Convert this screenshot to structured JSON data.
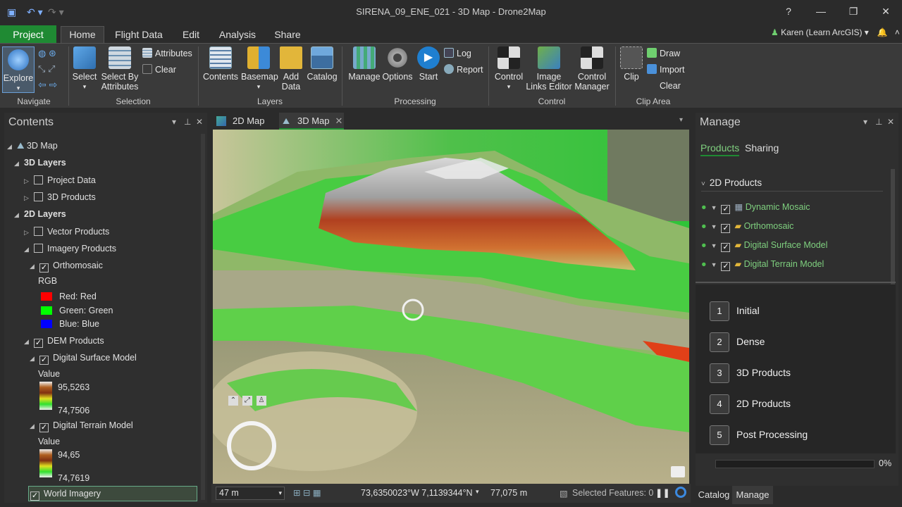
{
  "window": {
    "title": "SIRENA_09_ENE_021 - 3D Map - Drone2Map",
    "controls": [
      "?",
      "—",
      "❐",
      "✕"
    ]
  },
  "ribbon_tabs": [
    "Project",
    "Home",
    "Flight Data",
    "Edit",
    "Analysis",
    "Share"
  ],
  "active_tab": "Home",
  "user": "Karen (Learn ArcGIS) ▾",
  "groups": {
    "navigate": {
      "label": "Navigate",
      "explore": "Explore"
    },
    "selection": {
      "label": "Selection",
      "select": "Select",
      "select_by_attr_1": "Select By",
      "select_by_attr_2": "Attributes",
      "attributes": "Attributes",
      "clear": "Clear"
    },
    "layers": {
      "label": "Layers",
      "contents": "Contents",
      "basemap": "Basemap",
      "add_data_1": "Add",
      "add_data_2": "Data",
      "catalog": "Catalog"
    },
    "processing": {
      "label": "Processing",
      "manage": "Manage",
      "options": "Options",
      "start": "Start",
      "log": "Log",
      "report": "Report"
    },
    "control": {
      "label": "Control",
      "control": "Control",
      "image_links_1": "Image",
      "image_links_2": "Links Editor",
      "control_manager_1": "Control",
      "control_manager_2": "Manager"
    },
    "clip": {
      "label": "Clip Area",
      "clip": "Clip",
      "draw": "Draw",
      "import": "Import",
      "clear": "Clear"
    }
  },
  "contents": {
    "title": "Contents",
    "items": {
      "map3d": "3D Map",
      "layers3d": "3D Layers",
      "project_data": "Project Data",
      "products3d": "3D Products",
      "layers2d": "2D Layers",
      "vector": "Vector Products",
      "imagery": "Imagery Products",
      "ortho": "Orthomosaic",
      "rgb": "RGB",
      "red": "Red:  Red",
      "green": "Green: Green",
      "blue": "Blue:  Blue",
      "dem": "DEM Products",
      "dsm": "Digital Surface Model",
      "value1": "Value",
      "dsm_max": "95,5263",
      "dsm_min": "74,7506",
      "dtm": "Digital Terrain Model",
      "value2": "Value",
      "dtm_max": "94,65",
      "dtm_min": "74,7619",
      "world": "World Imagery"
    }
  },
  "map": {
    "tab2d": "2D Map",
    "tab3d": "3D Map",
    "scale": "47 m",
    "coords": "73,6350023°W 7,1139344°N",
    "elevation": "77,075 m",
    "selected": "Selected Features: 0"
  },
  "manage": {
    "title": "Manage",
    "tab_products": "Products",
    "tab_sharing": "Sharing",
    "section": "2D Products",
    "products": [
      "Dynamic Mosaic",
      "Orthomosaic",
      "Digital Surface Model",
      "Digital Terrain Model"
    ],
    "steps": [
      {
        "n": "1",
        "label": "Initial"
      },
      {
        "n": "2",
        "label": "Dense"
      },
      {
        "n": "3",
        "label": "3D Products"
      },
      {
        "n": "4",
        "label": "2D Products"
      },
      {
        "n": "5",
        "label": "Post Processing"
      }
    ],
    "progress": "0%"
  },
  "bottom_tabs": [
    "Catalog",
    "Manage"
  ],
  "colors": {
    "accent": "#1f8a33",
    "product_text": "#7fd07f"
  }
}
